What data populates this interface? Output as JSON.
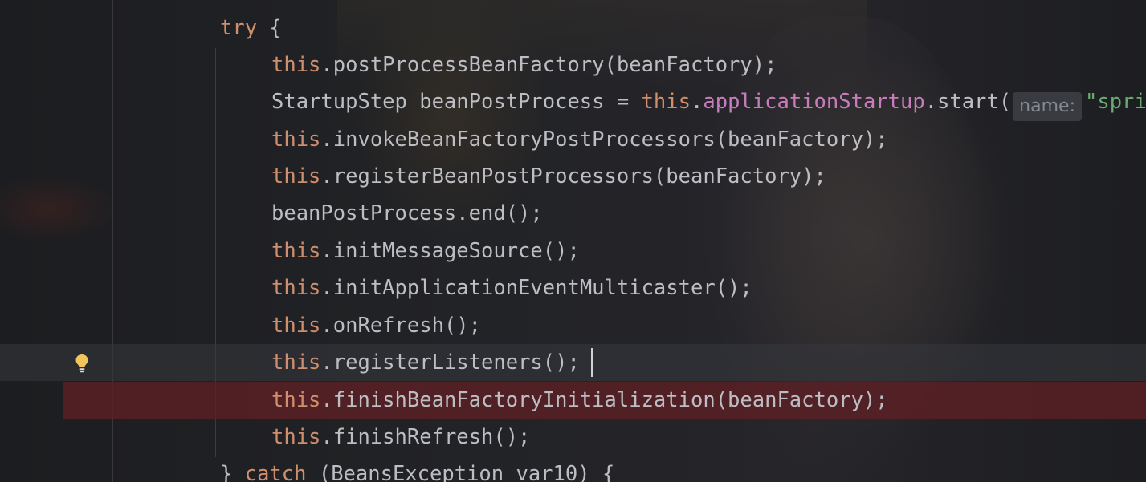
{
  "editor": {
    "inlay_hint": "name:",
    "lines": [
      {
        "parts": [
          {
            "t": "try",
            "c": "kw"
          },
          {
            "t": " {",
            "c": ""
          }
        ]
      },
      {
        "parts": [
          {
            "t": "this",
            "c": "kw"
          },
          {
            "t": ".postProcessBeanFactory(beanFactory);",
            "c": ""
          }
        ]
      },
      {
        "parts": [
          {
            "t": "StartupStep beanPostProcess = ",
            "c": ""
          },
          {
            "t": "this",
            "c": "kw"
          },
          {
            "t": ".",
            "c": ""
          },
          {
            "t": "applicationStartup",
            "c": "field"
          },
          {
            "t": ".start(",
            "c": ""
          },
          {
            "t": "name:",
            "c": "hint"
          },
          {
            "t": "\"spring.context.beans.post-process\");",
            "c": "str"
          }
        ]
      },
      {
        "parts": [
          {
            "t": "this",
            "c": "kw"
          },
          {
            "t": ".invokeBeanFactoryPostProcessors(beanFactory);",
            "c": ""
          }
        ]
      },
      {
        "parts": [
          {
            "t": "this",
            "c": "kw"
          },
          {
            "t": ".registerBeanPostProcessors(beanFactory);",
            "c": ""
          }
        ]
      },
      {
        "parts": [
          {
            "t": "beanPostProcess.end();",
            "c": ""
          }
        ]
      },
      {
        "parts": [
          {
            "t": "this",
            "c": "kw"
          },
          {
            "t": ".initMessageSource();",
            "c": ""
          }
        ]
      },
      {
        "parts": [
          {
            "t": "this",
            "c": "kw"
          },
          {
            "t": ".initApplicationEventMulticaster();",
            "c": ""
          }
        ]
      },
      {
        "parts": [
          {
            "t": "this",
            "c": "kw"
          },
          {
            "t": ".onRefresh();",
            "c": ""
          }
        ]
      },
      {
        "parts": [
          {
            "t": "this",
            "c": "kw"
          },
          {
            "t": ".registerListeners();",
            "c": ""
          }
        ]
      },
      {
        "parts": [
          {
            "t": "this",
            "c": "kw"
          },
          {
            "t": ".finishBeanFactoryInitialization(beanFactory);",
            "c": ""
          }
        ]
      },
      {
        "parts": [
          {
            "t": "this",
            "c": "kw"
          },
          {
            "t": ".finishRefresh();",
            "c": ""
          }
        ]
      },
      {
        "parts": [
          {
            "t": "} ",
            "c": ""
          },
          {
            "t": "catch",
            "c": "kw"
          },
          {
            "t": " (BeansException var10) {",
            "c": ""
          }
        ]
      }
    ]
  },
  "gutter": {
    "intention_icon": "lightbulb-icon"
  },
  "colors": {
    "keyword": "#cf8e6d",
    "field": "#c77dbb",
    "string": "#6aab73",
    "text": "#bcbec4",
    "current_line": "#2b2d30",
    "breakpoint_line": "#5c2024",
    "bulb": "#f2c55c"
  }
}
